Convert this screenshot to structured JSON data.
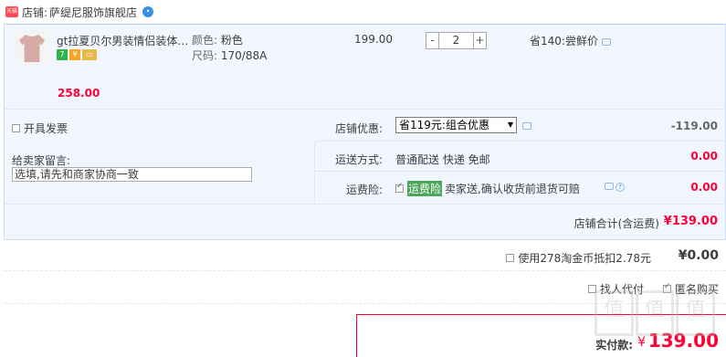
{
  "shop": {
    "tag": "天猫",
    "label": "店铺:",
    "name": "萨缇尼服饰旗舰店"
  },
  "item": {
    "title": "gt拉夏贝尔男装情侣装体…",
    "color_key": "颜色:",
    "color_val": "粉色",
    "size_key": "尺码:",
    "size_val": "170/88A",
    "unit_price": "199.00",
    "qty_minus": "-",
    "qty": "2",
    "qty_plus": "+",
    "saving": "省140:尝鲜价",
    "subtotal": "258.00",
    "badges": [
      "7",
      "¥",
      "▭"
    ]
  },
  "invoice": {
    "label": "开具发票"
  },
  "discount": {
    "label": "店铺优惠:",
    "selected": "省119元:组合优惠",
    "value": "-119.00"
  },
  "memo": {
    "label": "给卖家留言:",
    "placeholder": "选填,请先和商家协商一致"
  },
  "shipping": {
    "label": "运送方式:",
    "text": "普通配送 快递 免邮",
    "value": "0.00"
  },
  "insurance": {
    "label": "运费险:",
    "tag": "运费险",
    "text": "卖家送,确认收货前退货可赔",
    "value": "0.00"
  },
  "total": {
    "label": "店铺合计(含运费)",
    "value": "¥139.00"
  },
  "coins": {
    "text": "使用278淘金币抵扣2.78元",
    "value": "¥0.00"
  },
  "options": {
    "proxy_pay": "找人代付",
    "anonymous": "匿名购买"
  },
  "pay": {
    "label": "实付款:",
    "currency": "¥",
    "value": "139.00"
  },
  "watermark": [
    "值",
    "值",
    "值"
  ],
  "colors": {
    "accent": "#ff0036",
    "box_bg": "#f2f7ff",
    "border": "#b2d1ff"
  }
}
